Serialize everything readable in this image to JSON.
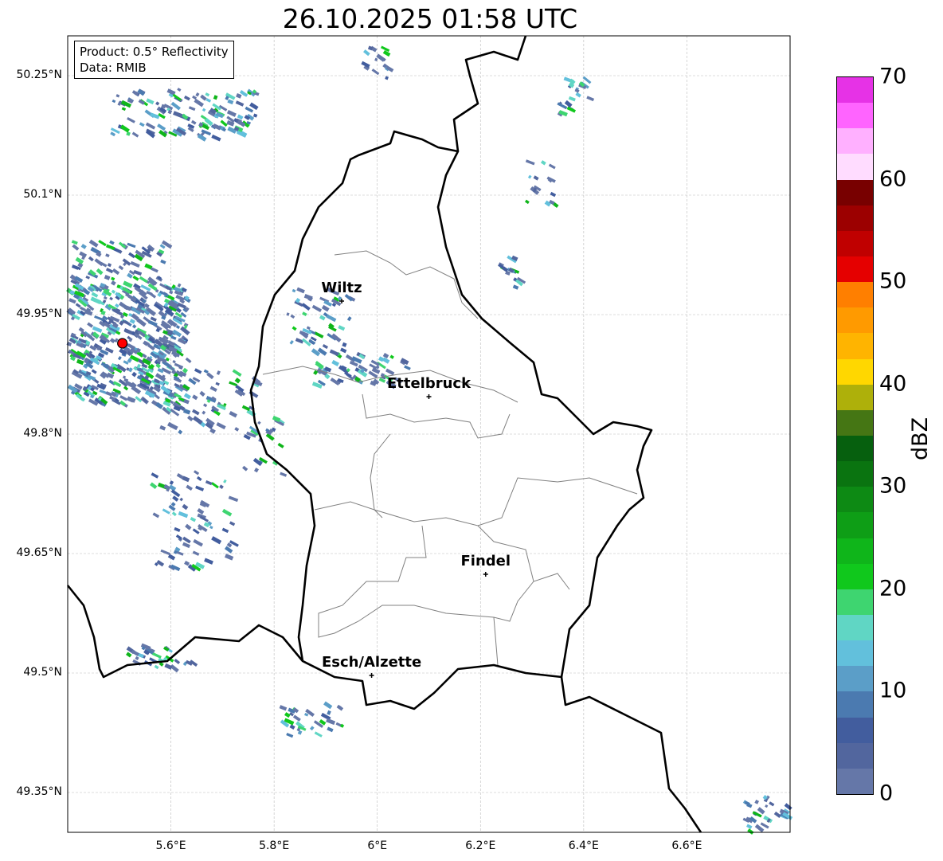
{
  "title": "26.10.2025 01:58 UTC",
  "info": {
    "product": "Product: 0.5° Reflectivity",
    "data": "Data: RMIB"
  },
  "lat_ticks": [
    "50.25°N",
    "50.1°N",
    "49.95°N",
    "49.8°N",
    "49.65°N",
    "49.5°N",
    "49.35°N"
  ],
  "lon_ticks": [
    "5.6°E",
    "5.8°E",
    "6°E",
    "6.2°E",
    "6.4°E",
    "6.6°E"
  ],
  "cities": [
    {
      "name": "Wiltz",
      "lon": 5.931,
      "lat": 49.967
    },
    {
      "name": "Ettelbruck",
      "lon": 6.1,
      "lat": 49.847
    },
    {
      "name": "Findel",
      "lon": 6.21,
      "lat": 49.624
    },
    {
      "name": "Esch/Alzette",
      "lon": 5.989,
      "lat": 49.497
    }
  ],
  "radar_site": {
    "lon": 5.506,
    "lat": 49.914,
    "color": "#ff0000"
  },
  "extent": {
    "lon": [
      5.4,
      6.8
    ],
    "lat": [
      49.3,
      50.3
    ]
  },
  "colorbar": {
    "label": "dBZ",
    "ticks": [
      "0",
      "10",
      "20",
      "30",
      "40",
      "50",
      "60",
      "70"
    ],
    "range": [
      0,
      70
    ],
    "step": 2.5,
    "colors": [
      "#6577a8",
      "#52669e",
      "#425d9e",
      "#4b7ab0",
      "#5b9ec8",
      "#62c0dc",
      "#60d6c4",
      "#3ed570",
      "#10c81c",
      "#0fb51a",
      "#0e9e16",
      "#0d8a14",
      "#0a7410",
      "#06600e",
      "#457614",
      "#aeb00a",
      "#ffd700",
      "#ffb400",
      "#ff9a00",
      "#ff7f00",
      "#e50000",
      "#c00000",
      "#9c0000",
      "#780000",
      "#ffdcff",
      "#ffb0ff",
      "#ff64ff",
      "#e632e6"
    ]
  }
}
